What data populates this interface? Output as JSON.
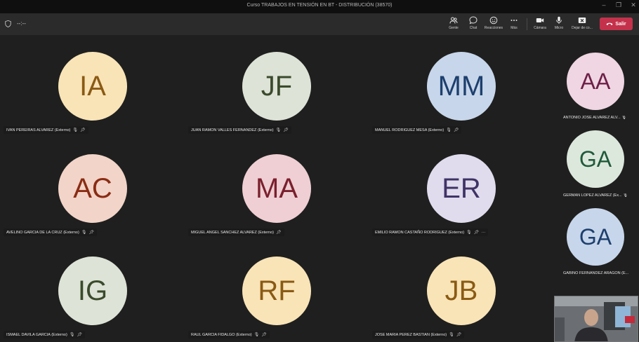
{
  "window": {
    "title": "Curso TRABAJOS EN TENSIÓN EN BT - DISTRIBUCIÓN (38570)"
  },
  "toolbar": {
    "timer": "--:--",
    "people_label": "Gente",
    "chat_label": "Chat",
    "reactions_label": "Reacciones",
    "more_label": "Más",
    "camera_label": "Cámara",
    "mic_label": "Micro",
    "share_label": "Dejar de co...",
    "leave_label": "Salir"
  },
  "participants": [
    {
      "initials": "IA",
      "name": "IVAN PEREIRAS ALVAREZ (Externo)",
      "bg": "#f9e4b7",
      "fg": "#8a5a14"
    },
    {
      "initials": "JF",
      "name": "JUAN RAMON VALLES FERNANDEZ (Externo)",
      "bg": "#dde3d6",
      "fg": "#3b4a2c"
    },
    {
      "initials": "MM",
      "name": "MANUEL RODRIGUEZ MESA (Externo)",
      "bg": "#c7d6ea",
      "fg": "#1d3f6e"
    },
    {
      "initials": "AC",
      "name": "AVELINO GARCIA DE LA CRUZ (Externo)",
      "bg": "#f2d4c8",
      "fg": "#8a2c14"
    },
    {
      "initials": "MA",
      "name": "MIGUEL ANGEL SANCHEZ ALVAREZ (Externo)",
      "bg": "#efcfd3",
      "fg": "#7a1f2e"
    },
    {
      "initials": "ER",
      "name": "EMILIO RAMON CASTAÑO RODRIGUEZ (Externo)",
      "bg": "#e0dced",
      "fg": "#3f3366"
    },
    {
      "initials": "IG",
      "name": "ISMAEL DAVILA GARCIA (Externo)",
      "bg": "#dde3d6",
      "fg": "#3b4a2c"
    },
    {
      "initials": "RF",
      "name": "RAUL GARCIA FIDALGO (Externo)",
      "bg": "#f9e4b7",
      "fg": "#8a5a14"
    },
    {
      "initials": "JB",
      "name": "JOSE MARIA PEREZ BASTIAN (Externo)",
      "bg": "#f9e4b7",
      "fg": "#8a5a14"
    }
  ],
  "sidebar": [
    {
      "initials": "AA",
      "name": "ANTONIO JOSE ALVAREZ ALV...",
      "bg": "#efd6e2",
      "fg": "#6e1f47"
    },
    {
      "initials": "GA",
      "name": "GERMAN LOPEZ ALVAREZ (Ex...",
      "bg": "#dde8dd",
      "fg": "#1f5a3a"
    },
    {
      "initials": "GA",
      "name": "GABINO FERNANDEZ ARAGON (E...",
      "bg": "#c7d6ea",
      "fg": "#1d3f6e"
    }
  ]
}
